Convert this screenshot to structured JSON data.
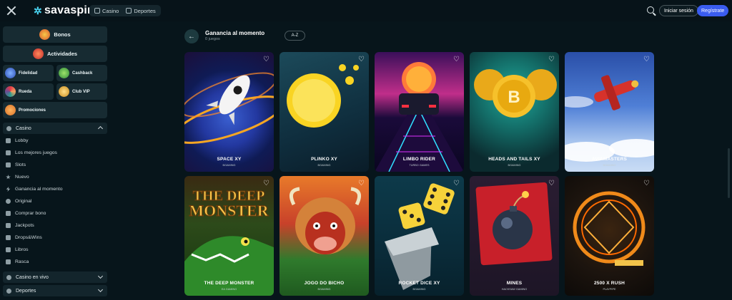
{
  "brand": {
    "name": "savaspin"
  },
  "topnav": {
    "casino": "Casino",
    "deportes": "Deportes"
  },
  "header": {
    "login": "Iniciar sesión",
    "register": "Regístrate"
  },
  "sidebar": {
    "bonos": "Bonos",
    "actividades": "Actividades",
    "fidelidad": "Fidelidad",
    "cashback": "Cashback",
    "rueda": "Rueda",
    "club_vip": "Club VIP",
    "promociones": "Promociones",
    "casino_section": "Casino",
    "items": [
      "Lobby",
      "Los mejores juegos",
      "Slots",
      "Nuevo",
      "Ganancia al momento",
      "Original",
      "Comprar bono",
      "Jackpots",
      "Drops&Wins",
      "Libros",
      "Rasca"
    ],
    "casino_en_vivo": "Casino en vivo",
    "deportes": "Deportes"
  },
  "main": {
    "title": "Ganancia al momento",
    "count": "0 juegos",
    "sort": "A-Z",
    "games": [
      {
        "name": "SPACE XY",
        "provider": "BGAMING"
      },
      {
        "name": "PLINKO XY",
        "provider": "BGAMING"
      },
      {
        "name": "LIMBO RIDER",
        "provider": "TURBO GAMES"
      },
      {
        "name": "HEADS AND TAILS XY",
        "provider": "BGAMING"
      },
      {
        "name": "AVIAMASTERS",
        "provider": "BGAMING"
      },
      {
        "name": "THE DEEP MONSTER",
        "provider": "EA GAMING"
      },
      {
        "name": "JOGO DO BICHO",
        "provider": "BGAMING"
      },
      {
        "name": "ROCKET DICE XY",
        "provider": "BGAMING"
      },
      {
        "name": "MINES",
        "provider": "HACKSAW GAMING"
      },
      {
        "name": "2500 X RUSH",
        "provider": "PLAYPIPE"
      }
    ],
    "deep_monster_art_text": [
      "THE DEEP",
      "MONSTER"
    ]
  },
  "icons": {
    "heart": "♡",
    "back": "←"
  }
}
